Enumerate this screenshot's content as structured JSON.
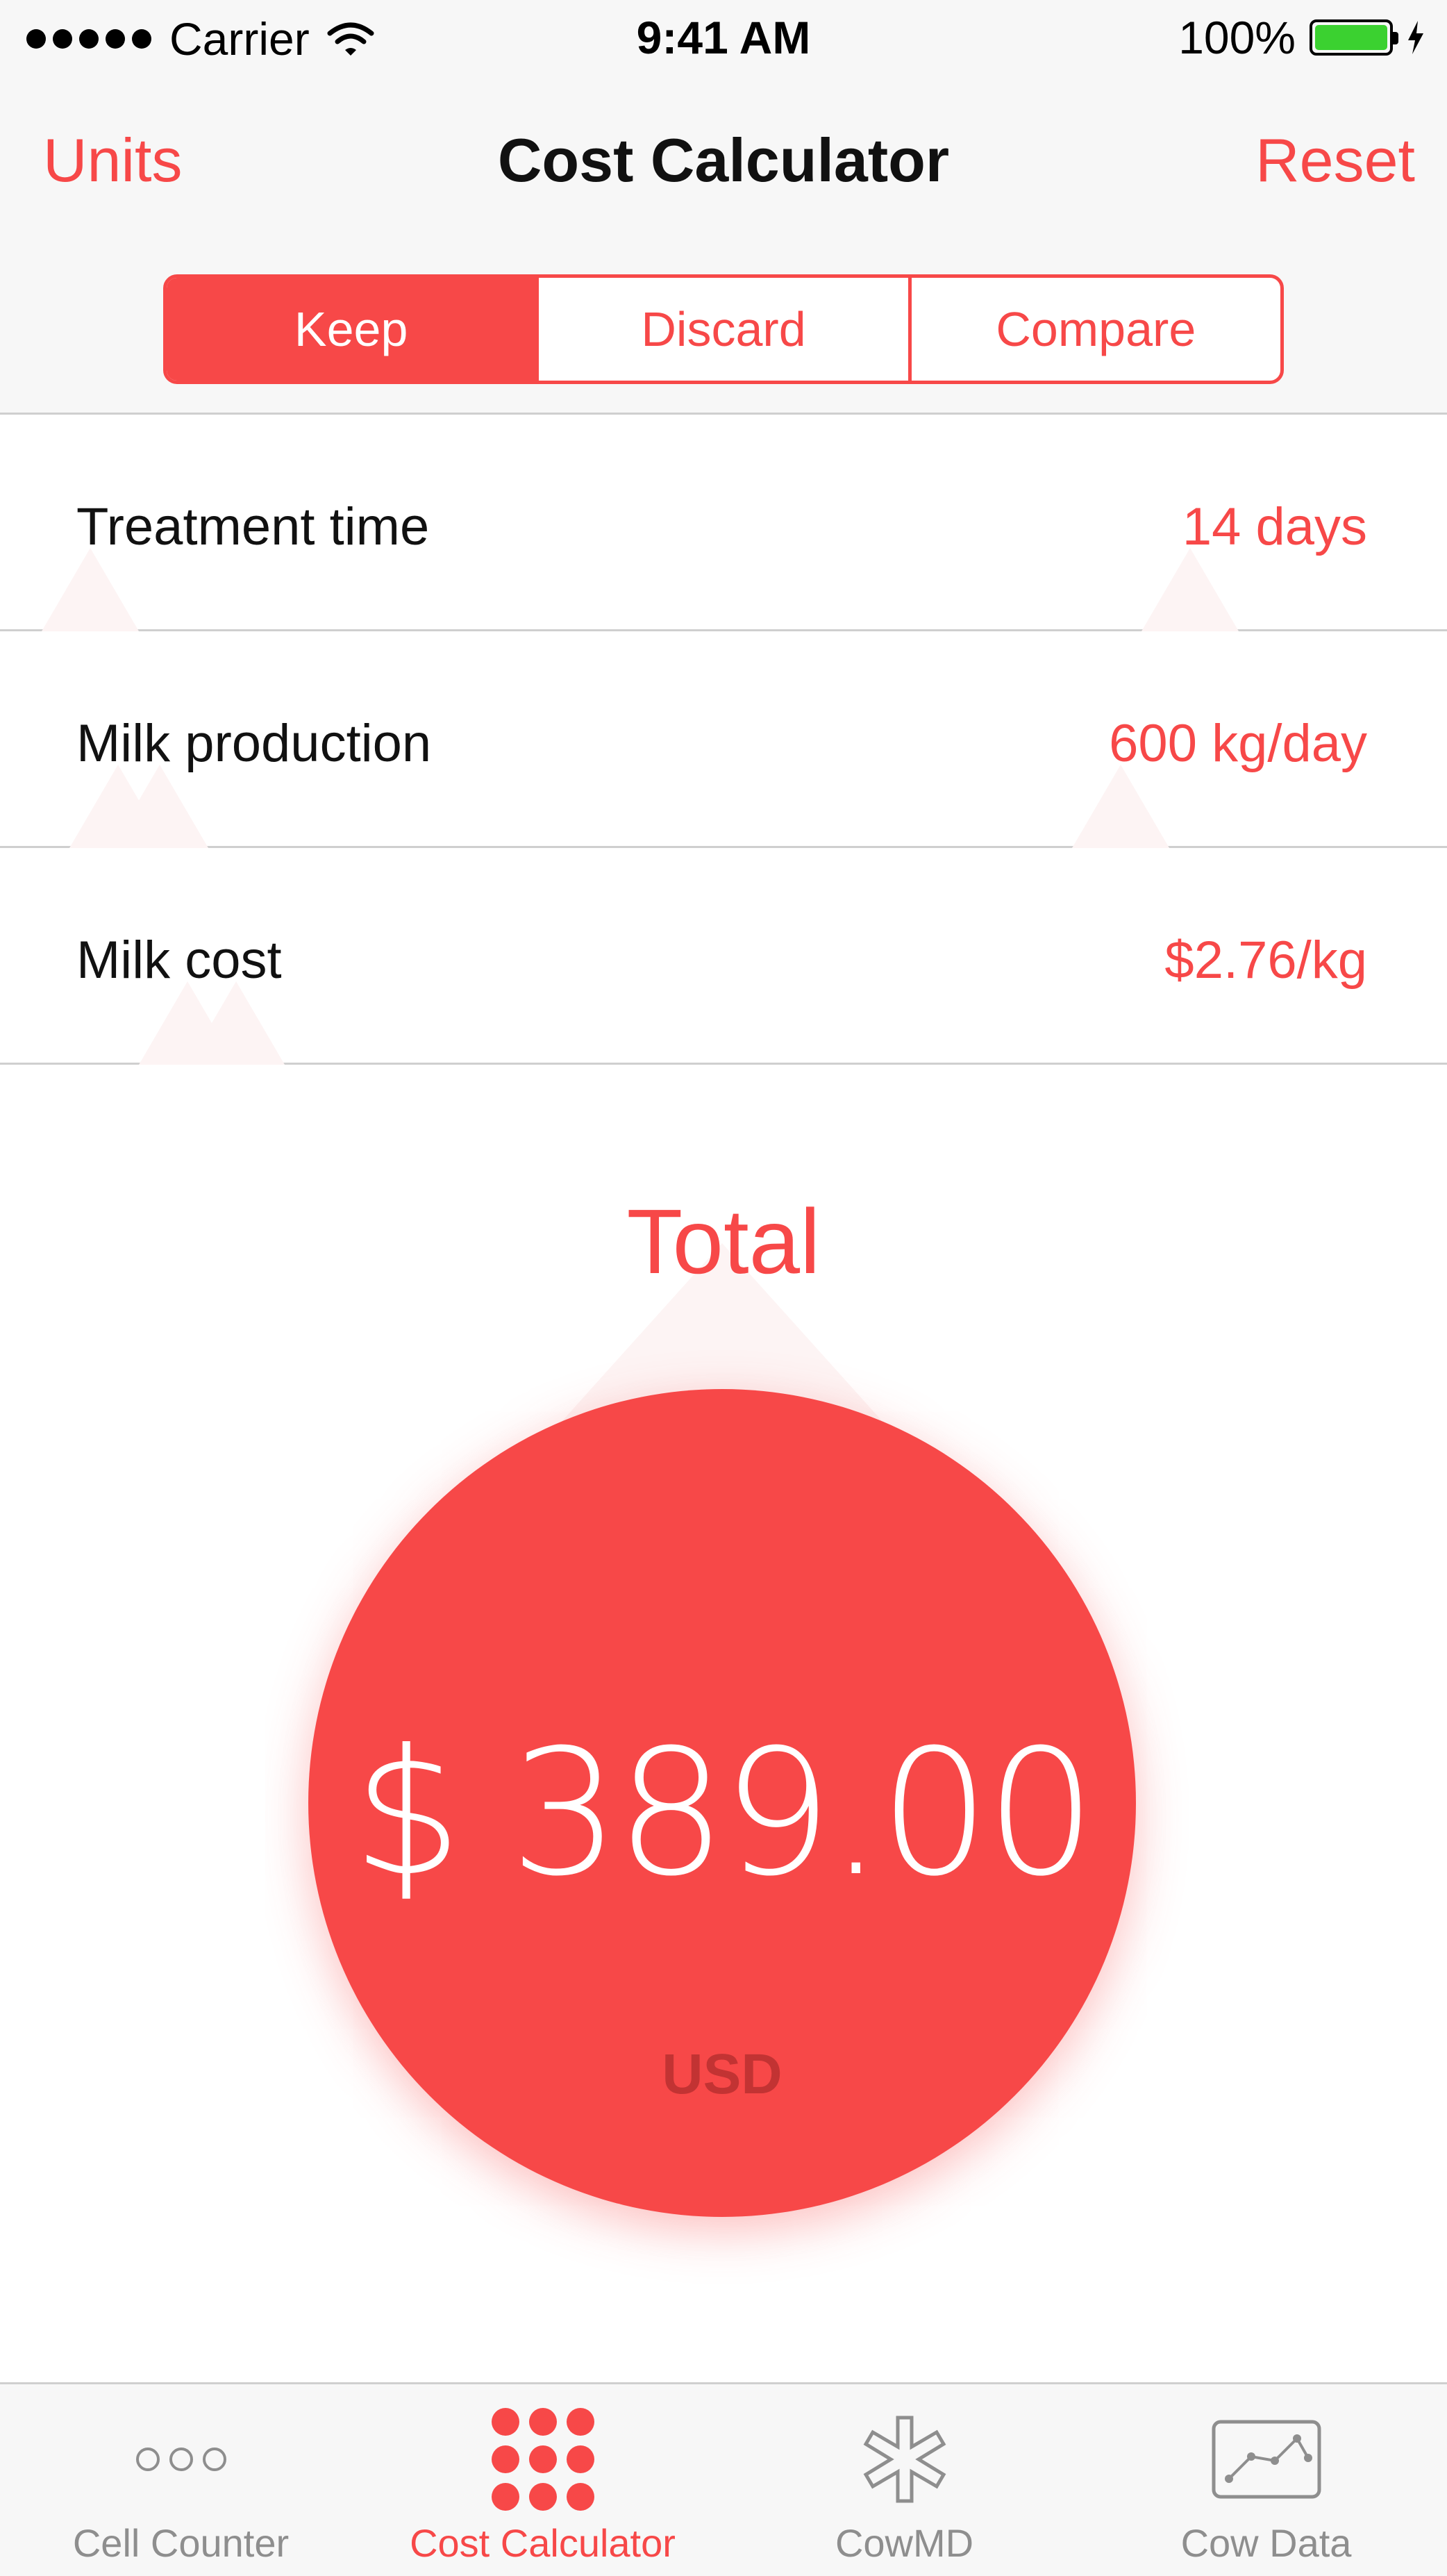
{
  "status_bar": {
    "carrier": "Carrier",
    "time": "9:41 AM",
    "battery": "100%",
    "icons": [
      "signal-dots-icon",
      "wifi-icon",
      "battery-icon",
      "charging-bolt-icon"
    ]
  },
  "nav": {
    "left_button": "Units",
    "title": "Cost Calculator",
    "right_button": "Reset"
  },
  "segments": {
    "items": [
      "Keep",
      "Discard",
      "Compare"
    ],
    "selected": "Keep"
  },
  "rows": [
    {
      "label": "Treatment time",
      "value": "14 days"
    },
    {
      "label": "Milk production",
      "value": "600 kg/day"
    },
    {
      "label": "Milk cost",
      "value": "$2.76/kg"
    }
  ],
  "total": {
    "label": "Total",
    "amount": "$ 389.00",
    "currency": "USD"
  },
  "tabbar": {
    "items": [
      {
        "label": "Cell Counter",
        "icon": "cell-counter-icon"
      },
      {
        "label": "Cost Calculator",
        "icon": "cost-calculator-icon"
      },
      {
        "label": "CowMD",
        "icon": "cowmd-icon"
      },
      {
        "label": "Cow Data",
        "icon": "cow-data-icon"
      }
    ],
    "selected": "Cost Calculator"
  },
  "colors": {
    "accent": "#f74848",
    "bar_background": "#f7f7f7",
    "separator": "#cfcfcf",
    "inactive": "#8e8e8e",
    "battery_fill": "#3bd130"
  }
}
